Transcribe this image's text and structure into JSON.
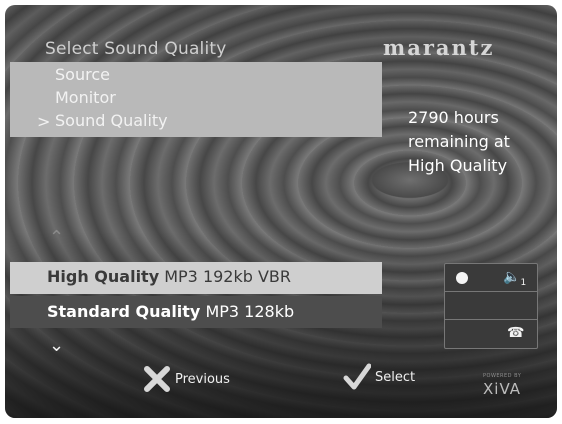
{
  "header": {
    "title": "Select Sound Quality",
    "brand": "marantz"
  },
  "menu": {
    "items": [
      {
        "label": "Source"
      },
      {
        "label": "Monitor"
      },
      {
        "label": "Sound Quality"
      }
    ],
    "selected_marker": ">"
  },
  "info": {
    "line1": "2790 hours",
    "line2": "remaining at",
    "line3": "High Quality"
  },
  "options": [
    {
      "name": "High Quality",
      "detail": "MP3 192kb VBR"
    },
    {
      "name": "Standard Quality",
      "detail": "MP3 128kb"
    }
  ],
  "status": {
    "record_icon": "record-dot-icon",
    "speaker_icon": "speaker-icon",
    "speaker_index": "1",
    "phone_icon": "phone-icon"
  },
  "footer": {
    "previous_label": "Previous",
    "select_label": "Select",
    "brand": "XiVA",
    "powered_by": "POWERED BY"
  },
  "colors": {
    "highlight": "#cfcfcf",
    "menu_panel": "#b9b9b9"
  }
}
